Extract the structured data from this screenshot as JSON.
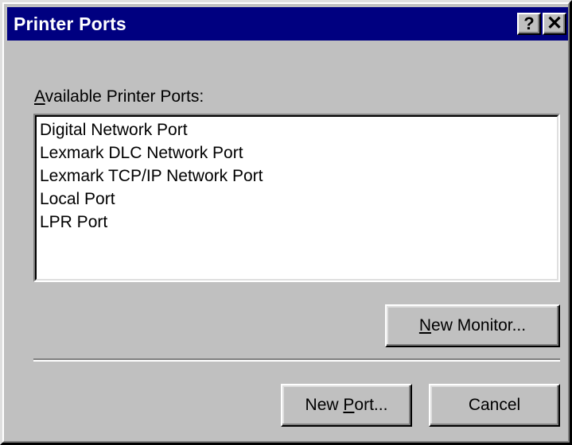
{
  "window": {
    "title": "Printer Ports",
    "help_glyph": "?",
    "close_glyph": "✕"
  },
  "ports": {
    "label_mnemonic": "A",
    "label_rest": "vailable Printer Ports:",
    "items": [
      "Digital Network Port",
      "Lexmark DLC Network Port",
      "Lexmark TCP/IP Network Port",
      "Local Port",
      "LPR Port"
    ]
  },
  "buttons": {
    "new_monitor_mnemonic": "N",
    "new_monitor_rest": "ew Monitor...",
    "new_port_pre": "New ",
    "new_port_mnemonic": "P",
    "new_port_rest": "ort...",
    "cancel": "Cancel"
  },
  "colors": {
    "titlebar": "#000080",
    "face": "#c0c0c0",
    "list_background": "#ffffff"
  },
  "icons": [
    "help-icon",
    "close-icon"
  ]
}
